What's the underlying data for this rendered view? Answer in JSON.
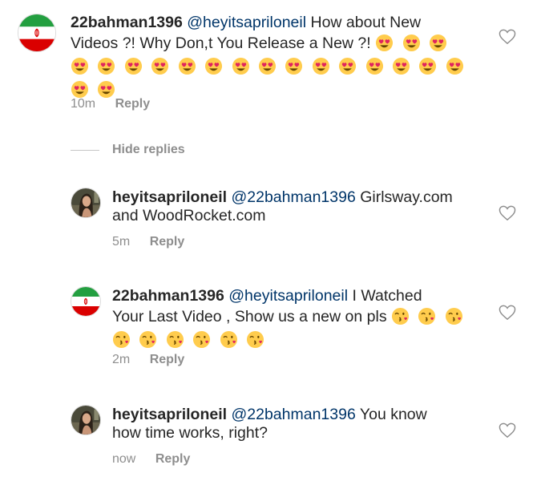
{
  "comments": [
    {
      "username": "22bahman1396",
      "mention": "@heyitsapriloneil",
      "text_line1": "How about New",
      "text_line2": "Videos ?! Why Don,t You Release a New ?!",
      "emoji_name": "heart-eyes-emoji",
      "emoji_count": 20,
      "time": "10m",
      "reply_label": "Reply"
    },
    {
      "username": "heyitsapriloneil",
      "mention": "@22bahman1396",
      "text_line1": "Girlsway.com",
      "text_line2": "and WoodRocket.com",
      "time": "5m",
      "reply_label": "Reply"
    },
    {
      "username": "22bahman1396",
      "mention": "@heyitsapriloneil",
      "text_line1": "I Watched",
      "text_line2": "Your Last Video , Show us a new on pls",
      "emoji_name": "kissing-emoji",
      "emoji_count": 9,
      "time": "2m",
      "reply_label": "Reply"
    },
    {
      "username": "heyitsapriloneil",
      "mention": "@22bahman1396",
      "text_line1": "You know",
      "text_line2": "how time works, right?",
      "time": "now",
      "reply_label": "Reply"
    }
  ],
  "hide_replies_label": "Hide replies",
  "icons": {
    "like": "heart-outline-icon",
    "flag_avatar": "iran-flag-avatar",
    "photo_avatar": "profile-photo-avatar"
  },
  "colors": {
    "mention": "#003569",
    "meta": "#8e8e8e",
    "flag_green": "#239f40",
    "flag_red": "#da0000"
  }
}
